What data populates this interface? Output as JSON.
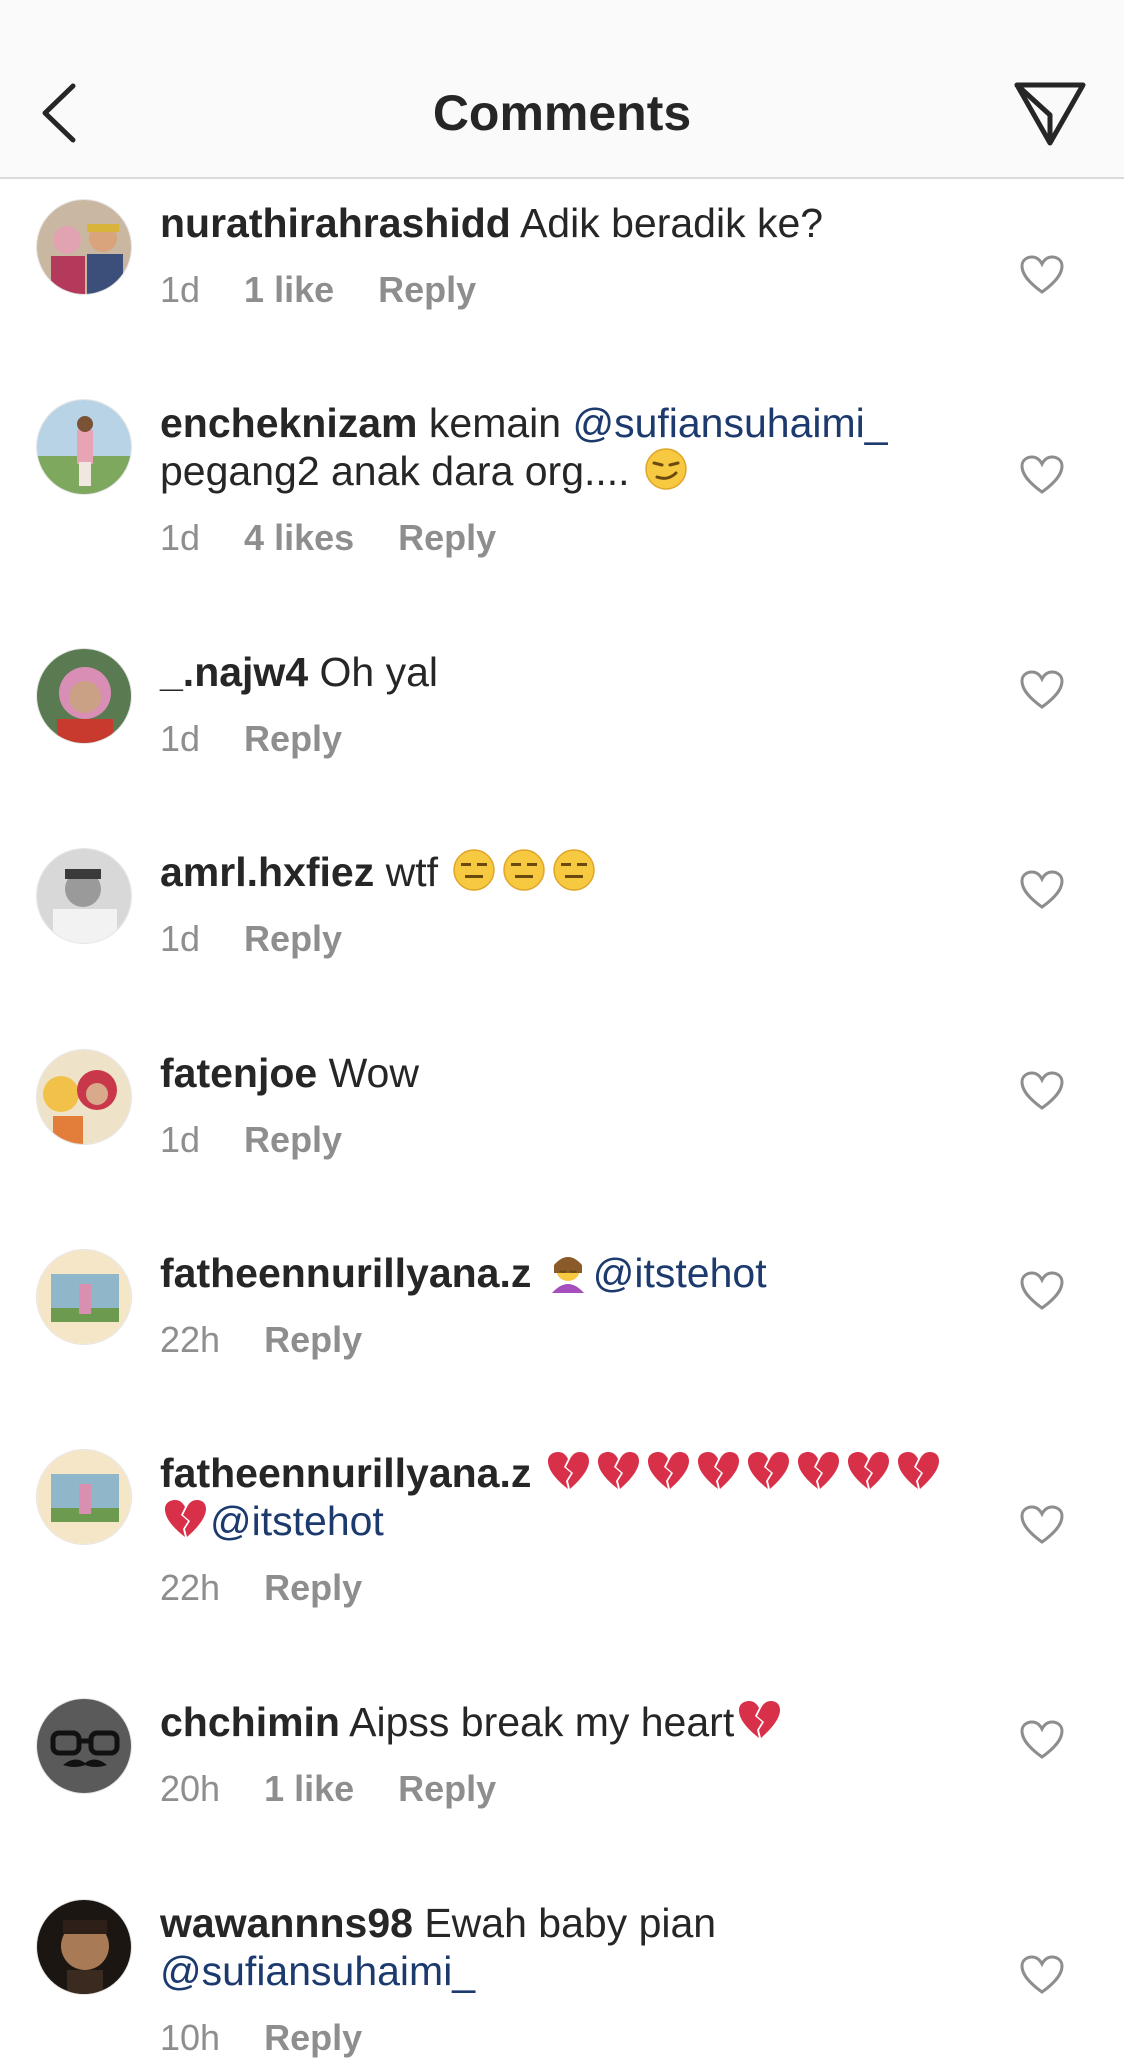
{
  "header": {
    "title": "Comments",
    "back_icon": "chevron-left-icon",
    "send_icon": "paper-plane-icon"
  },
  "colors": {
    "mention": "#1c3a6e",
    "meta": "#8e8e8e",
    "text": "#262626",
    "header_bg": "#fafafa"
  },
  "comments": [
    {
      "username": "nurathirahrashidd",
      "text": " Adik beradik ke?",
      "time": "1d",
      "likes": "1 like",
      "reply": "Reply"
    },
    {
      "username": "encheknizam",
      "text_a": " kemain ",
      "mention": "@sufiansuhaimi_",
      "text_b": "pegang2 anak dara org.... ",
      "emoji": "smirk-emoji",
      "time": "1d",
      "likes": "4 likes",
      "reply": "Reply"
    },
    {
      "username": "_.najw4",
      "text": " Oh yal",
      "time": "1d",
      "reply": "Reply"
    },
    {
      "username": "amrl.hxfiez",
      "text": " wtf ",
      "emoji": "expressionless-emoji",
      "time": "1d",
      "reply": "Reply"
    },
    {
      "username": "fatenjoe",
      "text": " Wow",
      "time": "1d",
      "reply": "Reply"
    },
    {
      "username": "fatheennurillyana.z",
      "emoji": "person-massage-emoji",
      "mention": "@itstehot",
      "time": "22h",
      "reply": "Reply"
    },
    {
      "username": "fatheennurillyana.z",
      "emoji": "broken-heart-emoji",
      "mention": "@itstehot",
      "time": "22h",
      "reply": "Reply"
    },
    {
      "username": "chchimin",
      "text": " Aipss break my heart",
      "emoji": "broken-heart-emoji",
      "time": "20h",
      "likes": "1 like",
      "reply": "Reply"
    },
    {
      "username": "wawannns98",
      "text": " Ewah baby pian",
      "mention": "@sufiansuhaimi_",
      "time": "10h",
      "reply": "Reply"
    }
  ]
}
